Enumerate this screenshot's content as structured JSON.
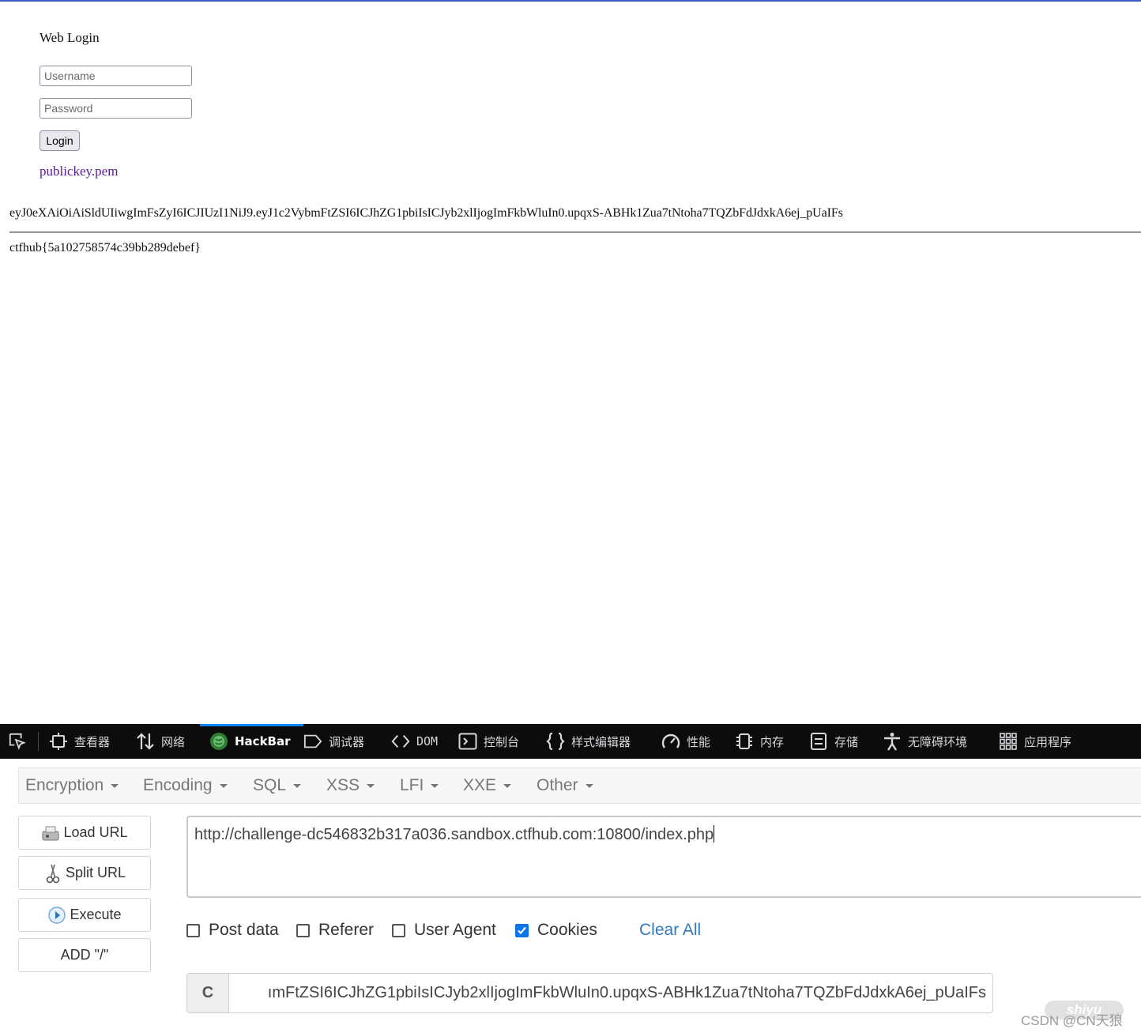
{
  "page": {
    "login_title": "Web Login",
    "username_placeholder": "Username",
    "password_placeholder": "Password",
    "login_button": "Login",
    "pubkey_link": "publickey.pem",
    "token": "eyJ0eXAiOiAiSldUIiwgImFsZyI6ICJIUzI1NiJ9.eyJ1c2VybmFtZSI6ICJhZG1pbiIsICJyb2xlIjogImFkbWluIn0.upqxS-ABHk1Zua7tNtoha7TQZbFdJdxkA6ej_pUaIFs",
    "flag": "ctfhub{5a102758574c39bb289debef}"
  },
  "devtools": {
    "tabs": [
      {
        "label": "查看器",
        "icon": "inspector-icon"
      },
      {
        "label": "网络",
        "icon": "network-icon"
      },
      {
        "label": "HackBar",
        "icon": "hackbar-icon",
        "active": true
      },
      {
        "label": "调试器",
        "icon": "debugger-icon"
      },
      {
        "label": "DOM",
        "icon": "dom-icon"
      },
      {
        "label": "控制台",
        "icon": "console-icon"
      },
      {
        "label": "样式编辑器",
        "icon": "style-editor-icon"
      },
      {
        "label": "性能",
        "icon": "performance-icon"
      },
      {
        "label": "内存",
        "icon": "memory-icon"
      },
      {
        "label": "存储",
        "icon": "storage-icon"
      },
      {
        "label": "无障碍环境",
        "icon": "accessibility-icon"
      },
      {
        "label": "应用程序",
        "icon": "application-icon"
      }
    ],
    "accent_color": "#0a84ff"
  },
  "hackbar": {
    "menus": [
      "Encryption",
      "Encoding",
      "SQL",
      "XSS",
      "LFI",
      "XXE",
      "Other"
    ],
    "buttons": {
      "load_url": "Load URL",
      "split_url": "Split URL",
      "execute": "Execute",
      "add_slash": "ADD \"/\""
    },
    "url": "http://challenge-dc546832b317a036.sandbox.ctfhub.com:10800/index.php",
    "options": [
      {
        "label": "Post data",
        "checked": false
      },
      {
        "label": "Referer",
        "checked": false
      },
      {
        "label": "User Agent",
        "checked": false
      },
      {
        "label": "Cookies",
        "checked": true
      }
    ],
    "clear_all": "Clear All",
    "cookie_prefix": "C",
    "cookie_value": "ımFtZSI6ICJhZG1pbiIsICJyb2xlIjogImFkbWluIn0.upqxS-ABHk1Zua7tNtoha7TQZbFdJdxkA6ej_pUaIFs"
  },
  "watermark": {
    "text": "CSDN @CN天狼",
    "badge": "shiyu"
  }
}
